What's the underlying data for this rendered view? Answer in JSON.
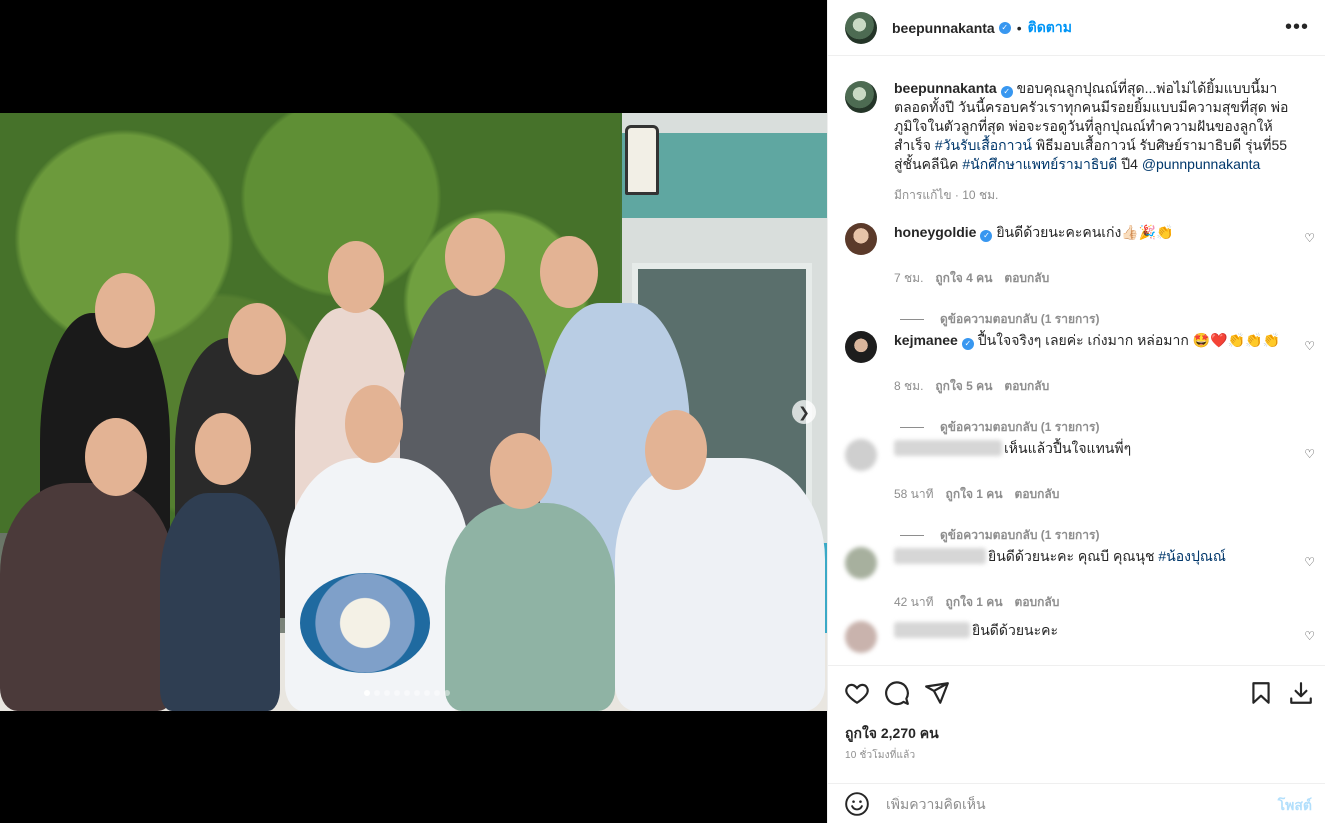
{
  "post": {
    "username": "beepunnakanta",
    "follow_label": "ติดตาม",
    "separator": "•",
    "more_icon": "more-horizontal-icon",
    "carousel": {
      "total": 9,
      "active": 0
    }
  },
  "caption": {
    "username": "beepunnakanta",
    "text_1": "ขอบคุณลูกปุณณ์ที่สุด...พ่อไม่ได้ยิ้มแบบนี้มาตลอดทั้งปี วันนี้ครอบครัวเราทุกคนมีรอยยิ้มแบบมีความสุขที่สุด พ่อภูมิใจในตัวลูกที่สุด พ่อจะรอดูวันที่ลูกปุณณ์ทำความฝันของลูกให้สำเร็จ ",
    "tag_1": "#วันรับเสื้อกาวน์",
    "text_2": " พิธีมอบเสื้อกาวน์ รับศิษย์รามาธิบดี รุ่นที่55 สู่ชั้นคลีนิค ",
    "tag_2": "#นักศึกษาแพทย์รามาธิบดี",
    "text_3": " ปี4 ",
    "mention": "@punnpunnakanta",
    "meta": "มีการแก้ไข · 10 ชม."
  },
  "comments": [
    {
      "username": "honeygoldie",
      "text": "ยินดีด้วยนะคะคนเก่ง👍🏻🎉👏",
      "time": "7 ชม.",
      "likes": "ถูกใจ 4 คน",
      "reply": "ตอบกลับ",
      "view_replies": "ดูข้อความตอบกลับ (1 รายการ)"
    },
    {
      "username": "kejmanee",
      "text": "ปื้นใจจริงๆ เลยค่ะ เก่งมาก หล่อมาก 🤩❤️👏👏👏",
      "time": "8 ชม.",
      "likes": "ถูกใจ 5 คน",
      "reply": "ตอบกลับ",
      "view_replies": "ดูข้อความตอบกลับ (1 รายการ)"
    },
    {
      "username": "",
      "text": "เห็นแล้วปื้นใจแทนพี่ๆ",
      "time": "58 นาที",
      "likes": "ถูกใจ 1 คน",
      "reply": "ตอบกลับ",
      "view_replies": "ดูข้อความตอบกลับ (1 รายการ)"
    },
    {
      "username": "",
      "text": "ยินดีด้วยนะคะ คุณบี คุณนุช ",
      "tag": "#น้องปุณณ์",
      "time": "42 นาที",
      "likes": "ถูกใจ 1 คน",
      "reply": "ตอบกลับ"
    },
    {
      "username": "",
      "text": "ยินดีด้วยนะคะ"
    }
  ],
  "actions": {
    "likes": "ถูกใจ 2,270 คน",
    "time": "10 ชั่วโมงที่แล้ว"
  },
  "composer": {
    "placeholder": "เพิ่มความคิดเห็น",
    "post_label": "โพสต์"
  },
  "colors": {
    "accent": "#0095f6",
    "verified": "#3897f0",
    "muted": "#8e8e8e"
  }
}
